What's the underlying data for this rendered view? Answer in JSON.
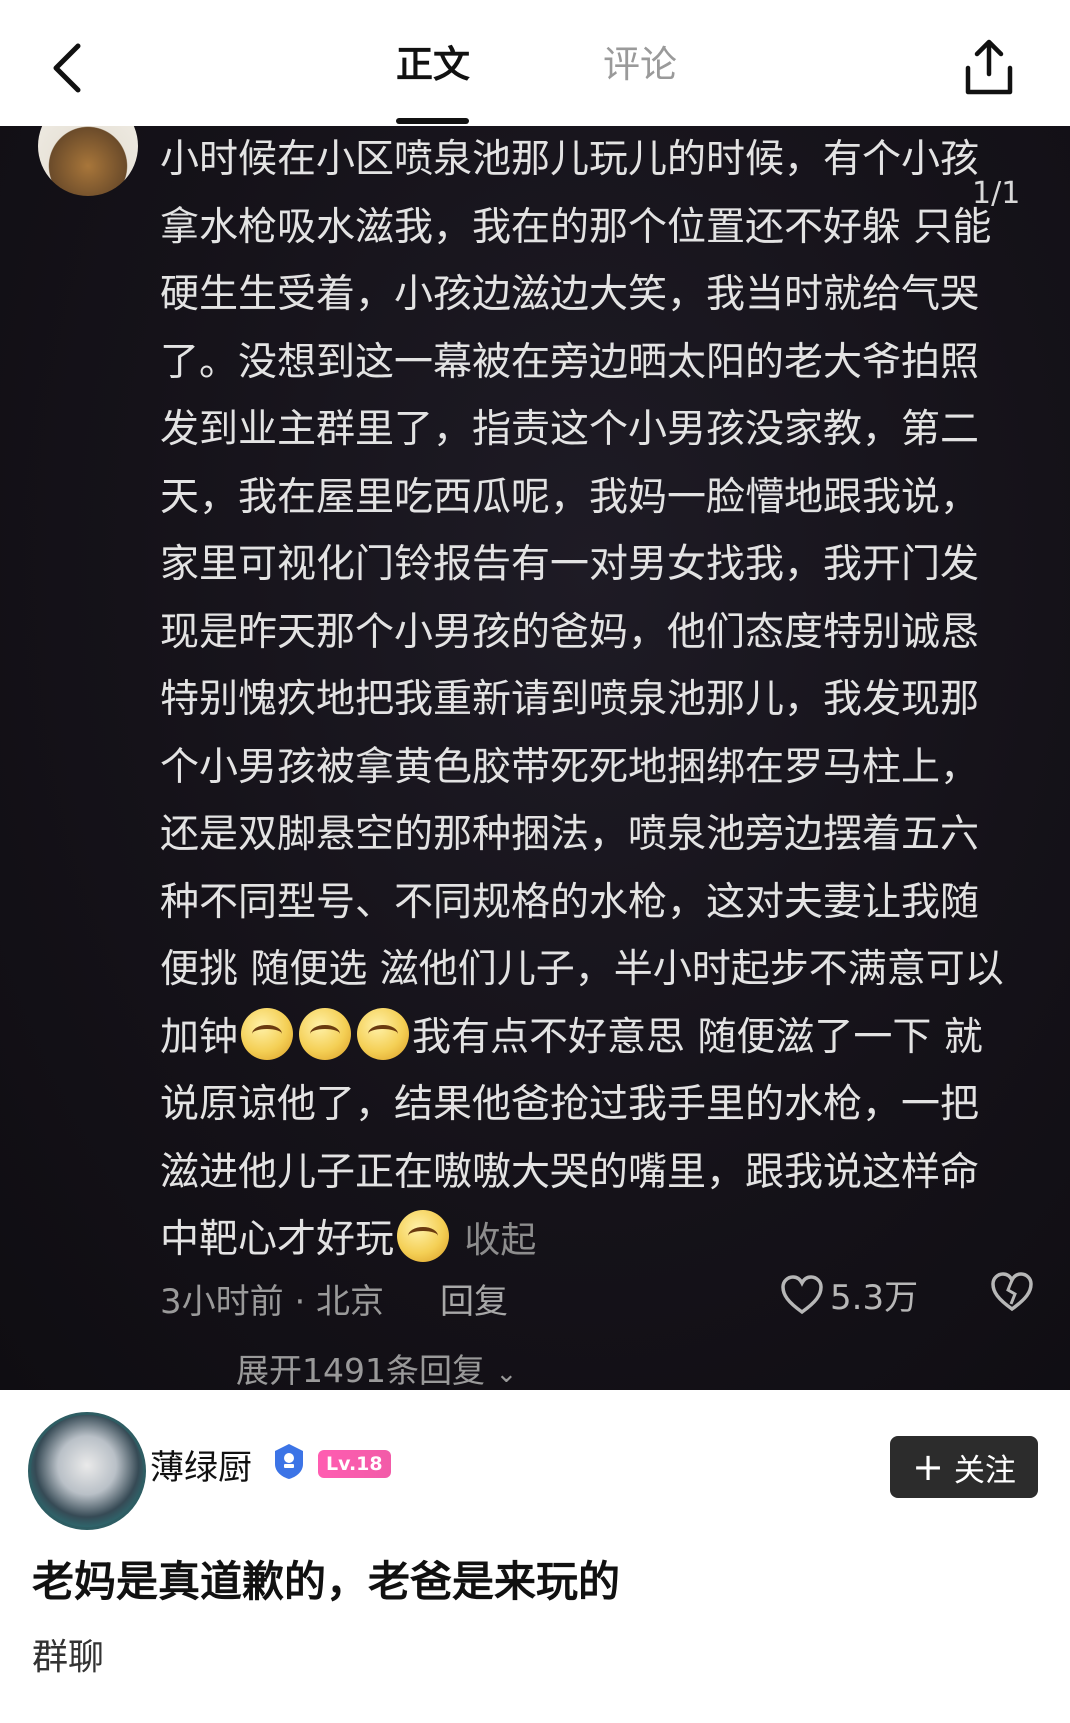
{
  "header": {
    "tabs": [
      {
        "label": "正文",
        "active": true
      },
      {
        "label": "评论",
        "active": false
      }
    ],
    "back_icon": "chevron-left-icon",
    "share_icon": "share-icon"
  },
  "screenshot": {
    "page_indicator": "1/1",
    "comment_lines": [
      "小时候在小区喷泉池那儿玩儿的时候，有个小孩",
      "拿水枪吸水滋我，我在的那个位置还不好躲 只能",
      "硬生生受着，小孩边滋边大笑，我当时就给气哭",
      "了。没想到这一幕被在旁边晒太阳的老大爷拍照",
      "发到业主群里了，指责这个小男孩没家教，第二",
      "天，我在屋里吃西瓜呢，我妈一脸懵地跟我说，",
      "家里可视化门铃报告有一对男女找我，我开门发",
      "现是昨天那个小男孩的爸妈，他们态度特别诚恳",
      "特别愧疚地把我重新请到喷泉池那儿，我发现那",
      "个小男孩被拿黄色胶带死死地捆绑在罗马柱上，",
      "还是双脚悬空的那种捆法，喷泉池旁边摆着五六",
      "种不同型号、不同规格的水枪，这对夫妻让我随",
      "便挑 随便选 滋他们儿子，半小时起步不满意可以"
    ],
    "line14_start": "加钟",
    "line14_end": "我有点不好意思 随便滋了一下 就",
    "line15": "说原谅他了，结果他爸抢过我手里的水枪，一把",
    "line16": "滋进他儿子正在嗷嗷大哭的嘴里，跟我说这样命",
    "line17_start": "中靶心才好玩",
    "collapse_label": "收起",
    "meta": "3小时前 · 北京",
    "reply_label": "回复",
    "likes": "5.3万",
    "expand_label": "展开1491条回复"
  },
  "author": {
    "name": "薄绿厨",
    "level": "Lv.18",
    "follow_label": "关注"
  },
  "post": {
    "title": "老妈是真道歉的，老爸是来玩的",
    "tag": "群聊"
  }
}
